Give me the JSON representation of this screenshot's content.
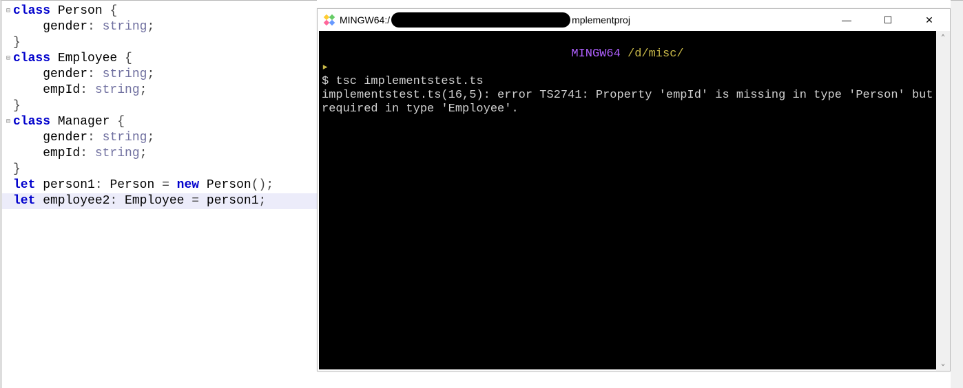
{
  "editor": {
    "code_lines": [
      {
        "fold": "⊟",
        "tokens": [
          {
            "cls": "kw",
            "t": "class"
          },
          {
            "cls": "ident",
            "t": " Person "
          },
          {
            "cls": "punct",
            "t": "{"
          }
        ]
      },
      {
        "fold": "",
        "tokens": [
          {
            "cls": "ident",
            "t": "    gender"
          },
          {
            "cls": "punct",
            "t": ":"
          },
          {
            "cls": "type",
            "t": " string"
          },
          {
            "cls": "punct",
            "t": ";"
          }
        ]
      },
      {
        "fold": "",
        "tokens": [
          {
            "cls": "punct",
            "t": "}"
          }
        ]
      },
      {
        "fold": "",
        "tokens": []
      },
      {
        "fold": "⊟",
        "tokens": [
          {
            "cls": "kw",
            "t": "class"
          },
          {
            "cls": "ident",
            "t": " Employee "
          },
          {
            "cls": "punct",
            "t": "{"
          }
        ]
      },
      {
        "fold": "",
        "tokens": [
          {
            "cls": "ident",
            "t": "    gender"
          },
          {
            "cls": "punct",
            "t": ":"
          },
          {
            "cls": "type",
            "t": " string"
          },
          {
            "cls": "punct",
            "t": ";"
          }
        ]
      },
      {
        "fold": "",
        "tokens": [
          {
            "cls": "ident",
            "t": "    empId"
          },
          {
            "cls": "punct",
            "t": ":"
          },
          {
            "cls": "type",
            "t": " string"
          },
          {
            "cls": "punct",
            "t": ";"
          }
        ]
      },
      {
        "fold": "",
        "tokens": [
          {
            "cls": "punct",
            "t": "}"
          }
        ]
      },
      {
        "fold": "",
        "tokens": []
      },
      {
        "fold": "⊟",
        "tokens": [
          {
            "cls": "kw",
            "t": "class"
          },
          {
            "cls": "ident",
            "t": " Manager "
          },
          {
            "cls": "punct",
            "t": "{"
          }
        ]
      },
      {
        "fold": "",
        "tokens": [
          {
            "cls": "ident",
            "t": "    gender"
          },
          {
            "cls": "punct",
            "t": ":"
          },
          {
            "cls": "type",
            "t": " string"
          },
          {
            "cls": "punct",
            "t": ";"
          }
        ]
      },
      {
        "fold": "",
        "tokens": [
          {
            "cls": "ident",
            "t": "    empId"
          },
          {
            "cls": "punct",
            "t": ":"
          },
          {
            "cls": "type",
            "t": " string"
          },
          {
            "cls": "punct",
            "t": ";"
          }
        ]
      },
      {
        "fold": "",
        "tokens": [
          {
            "cls": "punct",
            "t": "}"
          }
        ]
      },
      {
        "fold": "",
        "tokens": []
      },
      {
        "fold": "",
        "tokens": [
          {
            "cls": "kw",
            "t": "let"
          },
          {
            "cls": "ident",
            "t": " person1"
          },
          {
            "cls": "punct",
            "t": ":"
          },
          {
            "cls": "ident",
            "t": " Person "
          },
          {
            "cls": "punct",
            "t": "="
          },
          {
            "cls": "kw",
            "t": " new"
          },
          {
            "cls": "ident",
            "t": " Person"
          },
          {
            "cls": "punct",
            "t": "();"
          }
        ]
      },
      {
        "fold": "",
        "highlight": true,
        "tokens": [
          {
            "cls": "kw",
            "t": "let"
          },
          {
            "cls": "ident",
            "t": " employee2"
          },
          {
            "cls": "punct",
            "t": ":"
          },
          {
            "cls": "ident",
            "t": " Employee "
          },
          {
            "cls": "punct",
            "t": "="
          },
          {
            "cls": "ident",
            "t": " person1"
          },
          {
            "cls": "punct",
            "t": ";"
          }
        ]
      }
    ]
  },
  "terminal": {
    "title_prefix": "MINGW64:/",
    "title_suffix": "mplementproj",
    "header_env": "MINGW64",
    "header_path": " /d/misc/",
    "prompt": "$ ",
    "command": "tsc implementstest.ts",
    "error_line": "implementstest.ts(16,5): error TS2741: Property 'empId' is missing in type 'Person' but required in type 'Employee'."
  },
  "window_controls": {
    "minimize": "—",
    "maximize": "☐",
    "close": "✕"
  },
  "scroll": {
    "up": "⌃",
    "down": "⌄"
  }
}
